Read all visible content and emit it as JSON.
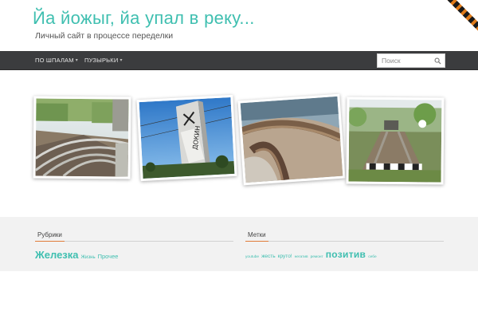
{
  "header": {
    "site_title": "Йа йожыг, йа упал в реку...",
    "site_description": "Личный сайт в процессе переделки"
  },
  "nav": {
    "items": [
      {
        "label": "По шпалам",
        "icon": "chevron-down-icon"
      },
      {
        "label": "Пузырьки",
        "icon": "chevron-down-icon"
      }
    ],
    "search": {
      "placeholder": "Поиск",
      "value": "",
      "icon": "search-icon"
    }
  },
  "gallery": {
    "photos": [
      {
        "subject": "railway tracks curving"
      },
      {
        "subject": "station sign against blue sky"
      },
      {
        "subject": "weathered rail close-up"
      },
      {
        "subject": "overgrown railway tracks"
      }
    ]
  },
  "footer_widgets": {
    "categories": {
      "title": "Рубрики",
      "items": [
        "Железка",
        "Жизнь",
        "Прочее"
      ]
    },
    "tags": {
      "title": "Метки",
      "items": [
        "youtube",
        "жесть",
        "круто!",
        "негатив",
        "ремонт",
        "позитив",
        "себе"
      ]
    }
  },
  "colors": {
    "accent": "#3fbfb0",
    "navbar": "#3b3c3e",
    "footer_bg": "#f2f2f2",
    "widget_underline": "#e07b3a"
  }
}
